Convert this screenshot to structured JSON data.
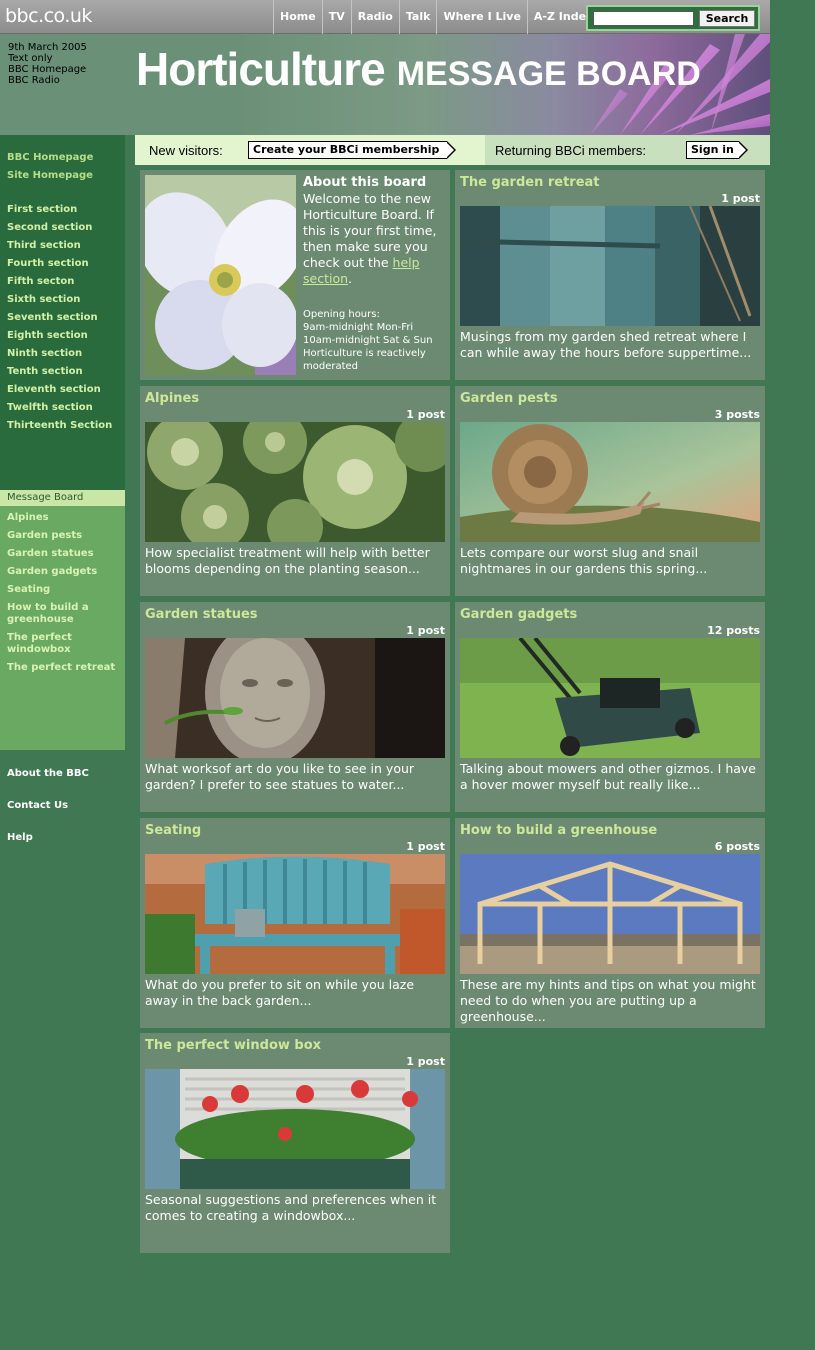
{
  "top": {
    "logo": "bbc.co.uk",
    "nav": [
      "Home",
      "TV",
      "Radio",
      "Talk",
      "Where I Live",
      "A-Z Index"
    ],
    "search_button": "Search"
  },
  "banner": {
    "date": "9th March 2005",
    "links": [
      "Text only",
      "BBC Homepage",
      "BBC Radio"
    ],
    "title_main": "Horticulture",
    "title_sub": "MESSAGE BOARD"
  },
  "membership": {
    "new_label": "New visitors:",
    "create_button": "Create your BBCi membership",
    "returning_label": "Returning BBCi members:",
    "signin_button": "Sign in"
  },
  "leftnav": {
    "home_links": [
      "BBC Homepage",
      "Site Homepage"
    ],
    "sections": [
      "First section",
      "Second section",
      "Third section",
      "Fourth section",
      "Fifth secton",
      "Sixth section",
      "Seventh section",
      "Eighth section",
      "Ninth section",
      "Tenth section",
      "Eleventh section",
      "Twelfth section",
      "Thirteenth Section"
    ],
    "board_label": "Message Board",
    "board_links": [
      "Alpines",
      "Garden pests",
      "Garden statues",
      "Garden gadgets",
      "Seating",
      "How to build a greenhouse",
      "The perfect windowbox",
      "The perfect retreat"
    ],
    "footer_links": [
      "About the BBC",
      "Contact Us",
      "Help"
    ]
  },
  "about": {
    "title": "About this board",
    "text": "Welcome to the new Horticulture Board. If this is your first time, then make sure you check out the",
    "link": "help section",
    "after_link": ".",
    "hours_label": "Opening hours:",
    "hours": [
      "9am-midnight Mon-Fri",
      "10am-midnight Sat & Sun"
    ],
    "moderation": "Horticulture is reactively moderated"
  },
  "cards": [
    {
      "title": "The garden retreat",
      "posts": "1 post",
      "desc": "Musings from my garden shed retreat where I can while away the hours before suppertime..."
    },
    {
      "title": "Alpines",
      "posts": "1 post",
      "desc": "How specialist treatment will help with better blooms depending on the planting season..."
    },
    {
      "title": "Garden pests",
      "posts": "3 posts",
      "desc": "Lets compare our worst slug and snail nightmares in our gardens this spring..."
    },
    {
      "title": "Garden statues",
      "posts": "1 post",
      "desc": "What worksof art do you like to see in your garden? I prefer to see statues to water..."
    },
    {
      "title": "Garden gadgets",
      "posts": "12 posts",
      "desc": "Talking about mowers and other gizmos. I have a hover mower myself but really like..."
    },
    {
      "title": "Seating",
      "posts": "1 post",
      "desc": "What do you prefer to sit on while you laze away in the back garden..."
    },
    {
      "title": "How to build a greenhouse",
      "posts": "6 posts",
      "desc": "These are my hints and tips on what you might need to do when you are putting up a greenhouse..."
    },
    {
      "title": "The perfect window box",
      "posts": "1 post",
      "desc": "Seasonal suggestions and preferences when it comes to creating a windowbox..."
    }
  ]
}
